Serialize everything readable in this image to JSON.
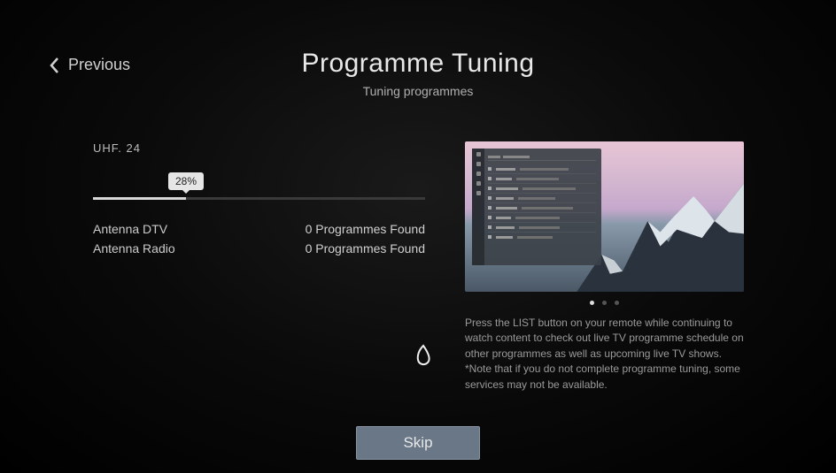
{
  "header": {
    "back_label": "Previous",
    "title": "Programme Tuning",
    "subtitle": "Tuning programmes"
  },
  "tuning": {
    "channel": "UHF. 24",
    "progress_percent": 28,
    "progress_label": "28%",
    "results": [
      {
        "label": "Antenna DTV",
        "value": "0 Programmes Found"
      },
      {
        "label": "Antenna Radio",
        "value": "0 Programmes Found"
      }
    ]
  },
  "carousel": {
    "count": 3,
    "active": 0
  },
  "help": {
    "text": "Press the LIST button on your remote while continuing to watch content to check out live TV programme schedule on other programmes as well as upcoming live TV shows.\n*Note that if you do not complete programme tuning, some services may not be available."
  },
  "footer": {
    "skip_label": "Skip"
  }
}
